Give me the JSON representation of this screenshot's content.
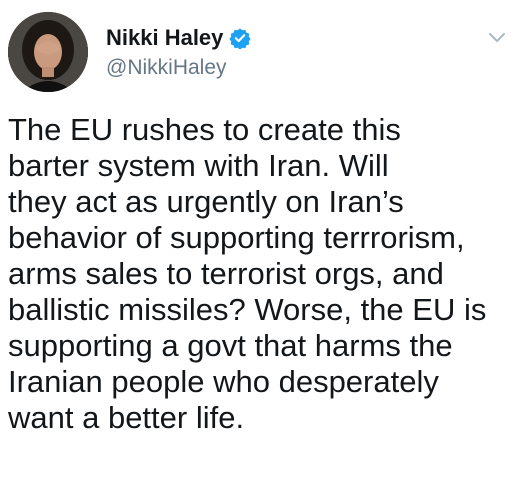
{
  "tweet": {
    "author": {
      "display_name": "Nikki Haley",
      "handle": "@NikkiHaley"
    },
    "icons": {
      "verified": "verified-badge-icon",
      "menu": "chevron-down-icon"
    },
    "colors": {
      "verified_blue": "#1da1f2",
      "handle_gray": "#657786",
      "chevron_gray": "#aab8c2"
    },
    "body_lines": [
      "The EU rushes to create this",
      "barter system with Iran. Will",
      "they act as urgently on Iran’s",
      "behavior of supporting terrrorism,",
      "arms sales to terrorist orgs, and",
      "ballistic missiles? Worse, the EU is",
      "supporting a govt that harms the",
      "Iranian people who desperately",
      "want a better life."
    ]
  }
}
